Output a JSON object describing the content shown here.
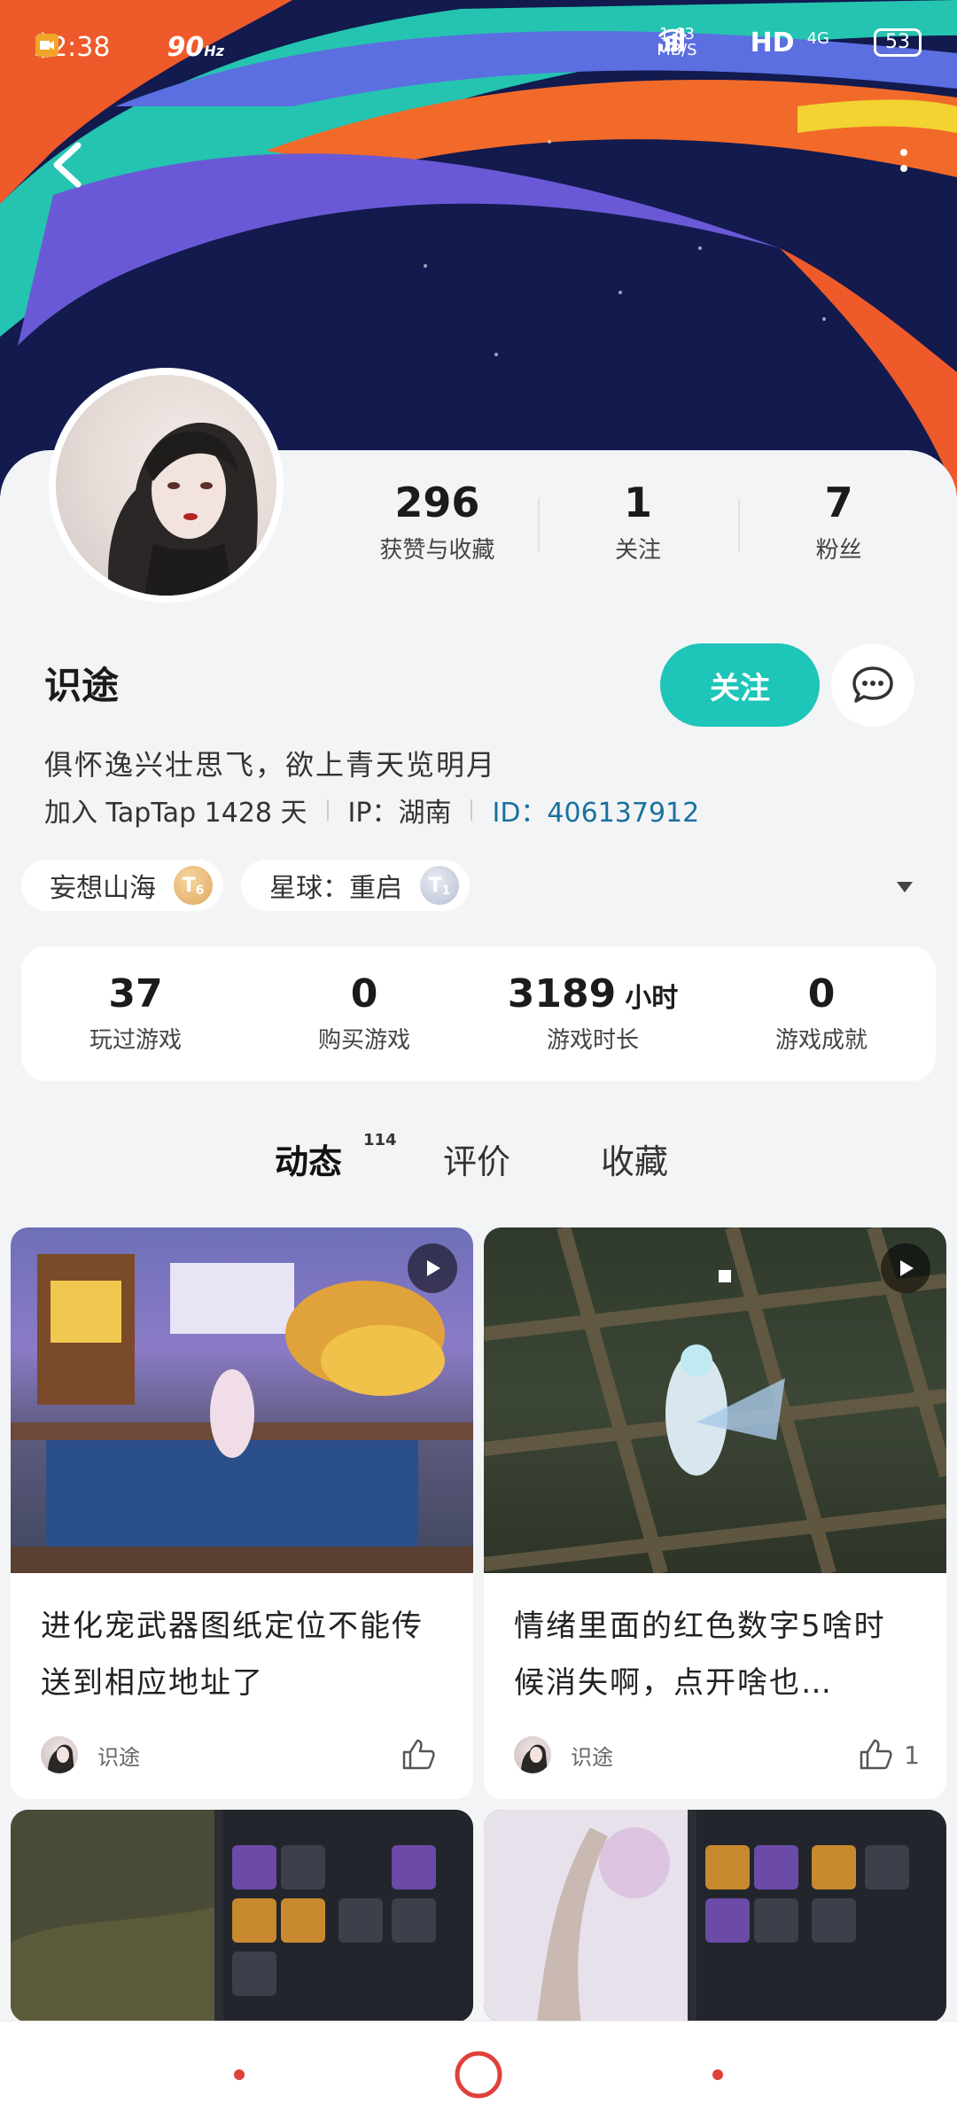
{
  "status_bar": {
    "time": "22:38",
    "refresh": "90",
    "refresh_unit": "Hz",
    "speed_value": "1.63",
    "speed_unit": "MB/S",
    "network": "HD",
    "network_gen": "4G",
    "battery": "53"
  },
  "profile": {
    "stats": [
      {
        "value": "296",
        "label": "获赞与收藏"
      },
      {
        "value": "1",
        "label": "关注"
      },
      {
        "value": "7",
        "label": "粉丝"
      }
    ],
    "name": "识途",
    "follow_label": "关注",
    "bio": "俱怀逸兴壮思飞，欲上青天览明月",
    "joined": "加入 TapTap 1428 天",
    "ip": "IP：湖南",
    "id": "ID：406137912",
    "badges": [
      {
        "label": "妄想山海",
        "coin": "T",
        "level": "6",
        "color": "#e0a860"
      },
      {
        "label": "星球：重启",
        "coin": "T",
        "level": "1",
        "color": "#b8bfd2"
      }
    ]
  },
  "game_stats": [
    {
      "value": "37",
      "unit": "",
      "label": "玩过游戏"
    },
    {
      "value": "0",
      "unit": "",
      "label": "购买游戏"
    },
    {
      "value": "3189",
      "unit": "小时",
      "label": "游戏时长"
    },
    {
      "value": "0",
      "unit": "",
      "label": "游戏成就"
    }
  ],
  "tabs": [
    {
      "label": "动态",
      "count": "114"
    },
    {
      "label": "评价",
      "count": ""
    },
    {
      "label": "收藏",
      "count": ""
    }
  ],
  "posts": [
    {
      "title": "进化宠武器图纸定位不能传送到相应地址了",
      "author": "识途",
      "likes": ""
    },
    {
      "title": "情绪里面的红色数字5啥时候消失啊，点开啥也…",
      "author": "识途",
      "likes": "1"
    }
  ],
  "colors": {
    "accent": "#1ec5b9",
    "banner_bg": "#121a4e",
    "id_blue": "#19719e"
  }
}
